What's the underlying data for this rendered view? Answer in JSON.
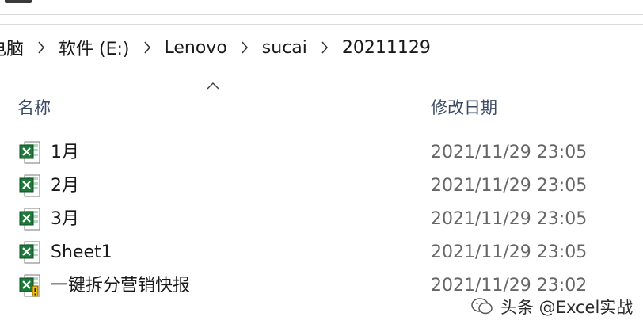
{
  "breadcrumb": {
    "items": [
      "电脑",
      "软件 (E:)",
      "Lenovo",
      "sucai",
      "20211129"
    ]
  },
  "columns": {
    "name": "名称",
    "date_modified": "修改日期"
  },
  "files": [
    {
      "name": "1月",
      "date": "2021/11/29 23:05",
      "icon": "excel-file-icon"
    },
    {
      "name": "2月",
      "date": "2021/11/29 23:05",
      "icon": "excel-file-icon"
    },
    {
      "name": "3月",
      "date": "2021/11/29 23:05",
      "icon": "excel-file-icon"
    },
    {
      "name": "Sheet1",
      "date": "2021/11/29 23:05",
      "icon": "excel-file-icon"
    },
    {
      "name": "一键拆分营销快报",
      "date": "2021/11/29 23:02",
      "icon": "excel-macro-file-icon"
    }
  ],
  "watermark": {
    "text": "头条 @Excel实战",
    "icon": "wechat-icon"
  },
  "colors": {
    "excel_green": "#1d7a3a",
    "header_text": "#3b4a66",
    "date_text": "#666666"
  }
}
